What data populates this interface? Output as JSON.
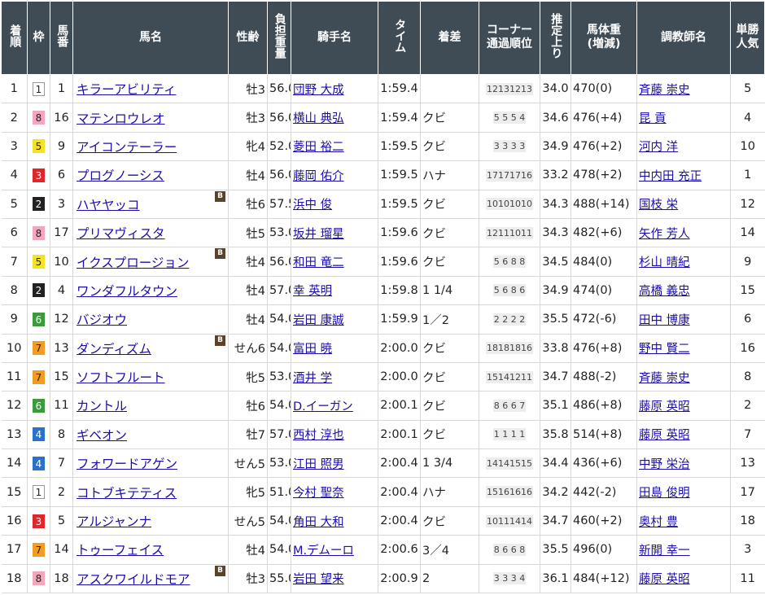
{
  "headers": {
    "place": "着順",
    "waku": "枠",
    "umaban": "馬番",
    "horse": "馬名",
    "sexage": "性齢",
    "weight": "負担重量",
    "jockey": "騎手名",
    "time": "タイム",
    "margin": "着差",
    "corner": "コーナー通過順位",
    "last3f": "推定上り",
    "bodyweight": "馬体重(増減)",
    "trainer": "調教師名",
    "pop": "単勝人気"
  },
  "waku_colors": {
    "1": {
      "bg": "#ffffff",
      "fg": "#222222"
    },
    "2": {
      "bg": "#222222",
      "fg": "#ffffff"
    },
    "3": {
      "bg": "#e0262b",
      "fg": "#ffffff"
    },
    "4": {
      "bg": "#2a72c9",
      "fg": "#ffffff"
    },
    "5": {
      "bg": "#f3e12a",
      "fg": "#222222"
    },
    "6": {
      "bg": "#3c9a3c",
      "fg": "#ffffff"
    },
    "7": {
      "bg": "#f39c23",
      "fg": "#222222"
    },
    "8": {
      "bg": "#f2a7bd",
      "fg": "#222222"
    }
  },
  "blinker_label": "B",
  "rows": [
    {
      "place": "1",
      "waku": "1",
      "umaban": "1",
      "horse": "キラーアビリティ",
      "blinker": false,
      "sexage": "牡3",
      "weight": "56.0",
      "jockey": "団野 大成",
      "time": "1:59.4",
      "margin": "",
      "corner": "12131213",
      "last3f": "34.0",
      "bodyweight": "470(0)",
      "trainer": "斉藤 崇史",
      "pop": "5"
    },
    {
      "place": "2",
      "waku": "8",
      "umaban": "16",
      "horse": "マテンロウレオ",
      "blinker": false,
      "sexage": "牡3",
      "weight": "56.0",
      "jockey": "横山 典弘",
      "time": "1:59.4",
      "margin": "クビ",
      "corner": "5 5 5 4",
      "last3f": "34.6",
      "bodyweight": "476(+4)",
      "trainer": "昆 貢",
      "pop": "4"
    },
    {
      "place": "3",
      "waku": "5",
      "umaban": "9",
      "horse": "アイコンテーラー",
      "blinker": false,
      "sexage": "牝4",
      "weight": "52.0",
      "jockey": "菱田 裕二",
      "time": "1:59.5",
      "margin": "クビ",
      "corner": "3 3 3 3",
      "last3f": "34.9",
      "bodyweight": "476(+2)",
      "trainer": "河内 洋",
      "pop": "10"
    },
    {
      "place": "4",
      "waku": "3",
      "umaban": "6",
      "horse": "プログノーシス",
      "blinker": false,
      "sexage": "牡4",
      "weight": "56.0",
      "jockey": "藤岡 佑介",
      "time": "1:59.5",
      "margin": "ハナ",
      "corner": "17171716",
      "last3f": "33.2",
      "bodyweight": "478(+2)",
      "trainer": "中内田 充正",
      "pop": "1"
    },
    {
      "place": "5",
      "waku": "2",
      "umaban": "3",
      "horse": "ハヤヤッコ",
      "blinker": true,
      "sexage": "牡6",
      "weight": "57.5",
      "jockey": "浜中 俊",
      "time": "1:59.5",
      "margin": "クビ",
      "corner": "10101010",
      "last3f": "34.3",
      "bodyweight": "488(+14)",
      "trainer": "国枝 栄",
      "pop": "12"
    },
    {
      "place": "6",
      "waku": "8",
      "umaban": "17",
      "horse": "プリマヴィスタ",
      "blinker": false,
      "sexage": "牡5",
      "weight": "53.0",
      "jockey": "坂井 瑠星",
      "time": "1:59.6",
      "margin": "クビ",
      "corner": "12111011",
      "last3f": "34.3",
      "bodyweight": "482(+6)",
      "trainer": "矢作 芳人",
      "pop": "14"
    },
    {
      "place": "7",
      "waku": "5",
      "umaban": "10",
      "horse": "イクスプロージョン",
      "blinker": true,
      "sexage": "牡4",
      "weight": "56.0",
      "jockey": "和田 竜二",
      "time": "1:59.6",
      "margin": "クビ",
      "corner": "5 6 8 8",
      "last3f": "34.5",
      "bodyweight": "484(0)",
      "trainer": "杉山 晴紀",
      "pop": "9"
    },
    {
      "place": "8",
      "waku": "2",
      "umaban": "4",
      "horse": "ワンダフルタウン",
      "blinker": false,
      "sexage": "牡4",
      "weight": "57.0",
      "jockey": "幸 英明",
      "time": "1:59.8",
      "margin": "1 1/4",
      "corner": "5 6 8 6",
      "last3f": "34.9",
      "bodyweight": "474(0)",
      "trainer": "高橋 義忠",
      "pop": "15"
    },
    {
      "place": "9",
      "waku": "6",
      "umaban": "12",
      "horse": "バジオウ",
      "blinker": false,
      "sexage": "牡4",
      "weight": "54.0",
      "jockey": "岩田 康誠",
      "time": "1:59.9",
      "margin": "1／2",
      "corner": "2 2 2 2",
      "last3f": "35.5",
      "bodyweight": "472(-6)",
      "trainer": "田中 博康",
      "pop": "6"
    },
    {
      "place": "10",
      "waku": "7",
      "umaban": "13",
      "horse": "ダンディズム",
      "blinker": true,
      "sexage": "せん6",
      "weight": "54.0",
      "jockey": "富田 暁",
      "time": "2:00.0",
      "margin": "クビ",
      "corner": "18181816",
      "last3f": "33.8",
      "bodyweight": "476(+8)",
      "trainer": "野中 賢二",
      "pop": "16"
    },
    {
      "place": "11",
      "waku": "7",
      "umaban": "15",
      "horse": "ソフトフルート",
      "blinker": false,
      "sexage": "牝5",
      "weight": "53.0",
      "jockey": "酒井 学",
      "time": "2:00.0",
      "margin": "クビ",
      "corner": "15141211",
      "last3f": "34.7",
      "bodyweight": "488(-2)",
      "trainer": "斉藤 崇史",
      "pop": "8"
    },
    {
      "place": "12",
      "waku": "6",
      "umaban": "11",
      "horse": "カントル",
      "blinker": false,
      "sexage": "牡6",
      "weight": "54.0",
      "jockey": "D.イーガン",
      "time": "2:00.1",
      "margin": "クビ",
      "corner": "8 6 6 7",
      "last3f": "35.1",
      "bodyweight": "486(+8)",
      "trainer": "藤原 英昭",
      "pop": "2"
    },
    {
      "place": "13",
      "waku": "4",
      "umaban": "8",
      "horse": "ギベオン",
      "blinker": false,
      "sexage": "牡7",
      "weight": "57.0",
      "jockey": "西村 淳也",
      "time": "2:00.1",
      "margin": "クビ",
      "corner": "1 1 1 1",
      "last3f": "35.8",
      "bodyweight": "514(+8)",
      "trainer": "藤原 英昭",
      "pop": "7"
    },
    {
      "place": "14",
      "waku": "4",
      "umaban": "7",
      "horse": "フォワードアゲン",
      "blinker": false,
      "sexage": "せん5",
      "weight": "53.0",
      "jockey": "江田 照男",
      "time": "2:00.4",
      "margin": "1 3/4",
      "corner": "14141515",
      "last3f": "34.4",
      "bodyweight": "436(+6)",
      "trainer": "中野 栄治",
      "pop": "13"
    },
    {
      "place": "15",
      "waku": "1",
      "umaban": "2",
      "horse": "コトブキテティス",
      "blinker": false,
      "sexage": "牝5",
      "weight": "51.0",
      "jockey": "今村 聖奈",
      "time": "2:00.4",
      "margin": "ハナ",
      "corner": "15161616",
      "last3f": "34.2",
      "bodyweight": "442(-2)",
      "trainer": "田島 俊明",
      "pop": "17"
    },
    {
      "place": "16",
      "waku": "3",
      "umaban": "5",
      "horse": "アルジャンナ",
      "blinker": false,
      "sexage": "せん5",
      "weight": "54.0",
      "jockey": "角田 大和",
      "time": "2:00.4",
      "margin": "クビ",
      "corner": "10111414",
      "last3f": "34.7",
      "bodyweight": "460(+2)",
      "trainer": "奥村 豊",
      "pop": "18"
    },
    {
      "place": "17",
      "waku": "7",
      "umaban": "14",
      "horse": "トゥーフェイス",
      "blinker": false,
      "sexage": "牡4",
      "weight": "54.0",
      "jockey": "M.デムーロ",
      "time": "2:00.6",
      "margin": "3／4",
      "corner": "8 6 6 8",
      "last3f": "35.5",
      "bodyweight": "496(0)",
      "trainer": "新開 幸一",
      "pop": "3"
    },
    {
      "place": "18",
      "waku": "8",
      "umaban": "18",
      "horse": "アスクワイルドモア",
      "blinker": true,
      "sexage": "牡3",
      "weight": "55.0",
      "jockey": "岩田 望来",
      "time": "2:00.9",
      "margin": "2",
      "corner": "3 3 3 4",
      "last3f": "36.1",
      "bodyweight": "484(+12)",
      "trainer": "藤原 英昭",
      "pop": "11"
    }
  ]
}
